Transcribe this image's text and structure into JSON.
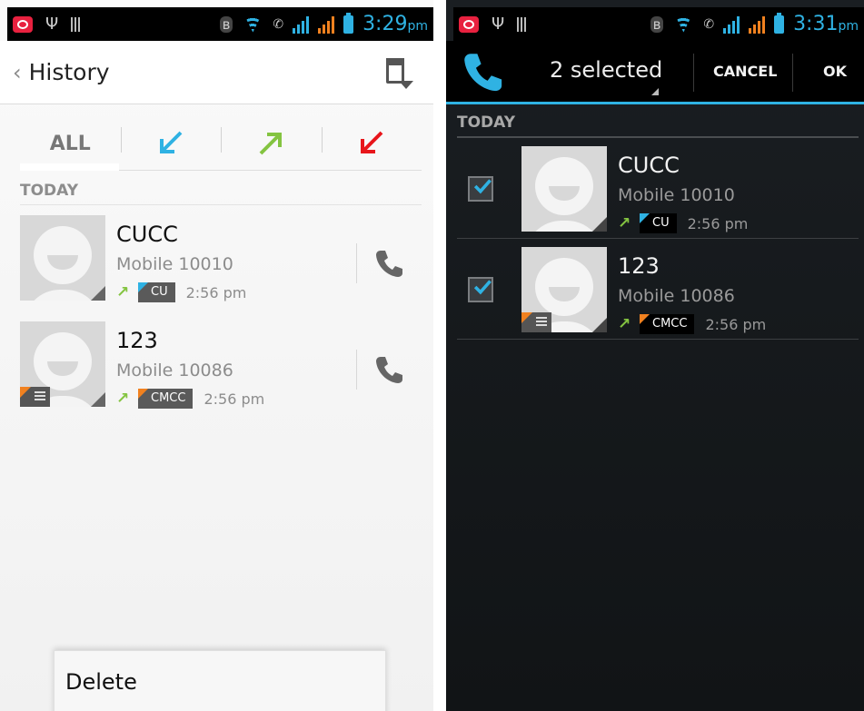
{
  "left": {
    "status": {
      "time": "3:29",
      "ampm": "pm"
    },
    "header": {
      "title": "History"
    },
    "tabs": {
      "all": "ALL"
    },
    "section": "TODAY",
    "calls": [
      {
        "name": "CUCC",
        "number": "Mobile 10010",
        "sim": "CU",
        "time": "2:56 pm"
      },
      {
        "name": "123",
        "number": "Mobile 10086",
        "sim": "CMCC",
        "time": "2:56 pm"
      }
    ],
    "popup": {
      "delete": "Delete"
    }
  },
  "right": {
    "status": {
      "time": "3:31",
      "ampm": "pm"
    },
    "action_bar": {
      "selected": "2 selected",
      "cancel": "CANCEL",
      "ok": "OK"
    },
    "section": "TODAY",
    "calls": [
      {
        "name": "CUCC",
        "number": "Mobile 10010",
        "sim": "CU",
        "time": "2:56 pm"
      },
      {
        "name": "123",
        "number": "Mobile 10086",
        "sim": "CMCC",
        "time": "2:56 pm"
      }
    ]
  },
  "colors": {
    "accent": "#2fb2e3",
    "outgoing": "#84c441",
    "missed": "#e8161b",
    "sim_orange": "#f1811f"
  }
}
